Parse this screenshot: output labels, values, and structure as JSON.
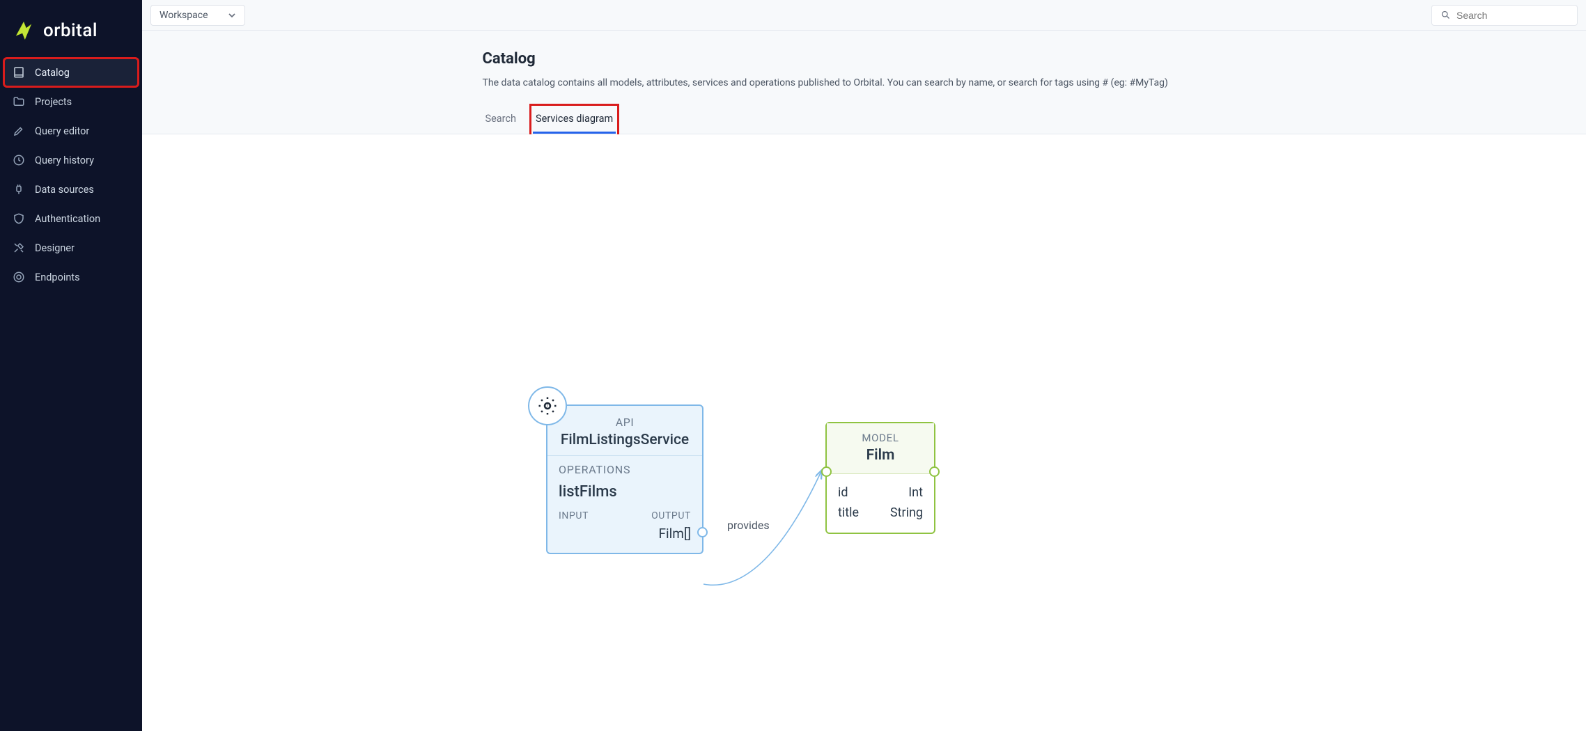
{
  "brand": {
    "name": "orbital"
  },
  "topbar": {
    "workspace_label": "Workspace",
    "search_placeholder": "Search"
  },
  "sidebar": {
    "items": [
      {
        "label": "Catalog",
        "icon": "book"
      },
      {
        "label": "Projects",
        "icon": "folder"
      },
      {
        "label": "Query editor",
        "icon": "pencil"
      },
      {
        "label": "Query history",
        "icon": "clock"
      },
      {
        "label": "Data sources",
        "icon": "plug"
      },
      {
        "label": "Authentication",
        "icon": "shield"
      },
      {
        "label": "Designer",
        "icon": "tools"
      },
      {
        "label": "Endpoints",
        "icon": "target"
      }
    ]
  },
  "page": {
    "title": "Catalog",
    "description": "The data catalog contains all models, attributes, services and operations published to Orbital. You can search by name, or search for tags using # (eg: #MyTag)"
  },
  "tabs": [
    {
      "label": "Search",
      "active": false
    },
    {
      "label": "Services diagram",
      "active": true
    }
  ],
  "diagram": {
    "api": {
      "type": "API",
      "name": "FilmListingsService",
      "operations_label": "OPERATIONS",
      "operation": "listFilms",
      "input_label": "INPUT",
      "input_value": "",
      "output_label": "OUTPUT",
      "output_value": "Film[]"
    },
    "edge_label": "provides",
    "model": {
      "type": "MODEL",
      "name": "Film",
      "fields": [
        {
          "name": "id",
          "type": "Int"
        },
        {
          "name": "title",
          "type": "String"
        }
      ]
    }
  }
}
